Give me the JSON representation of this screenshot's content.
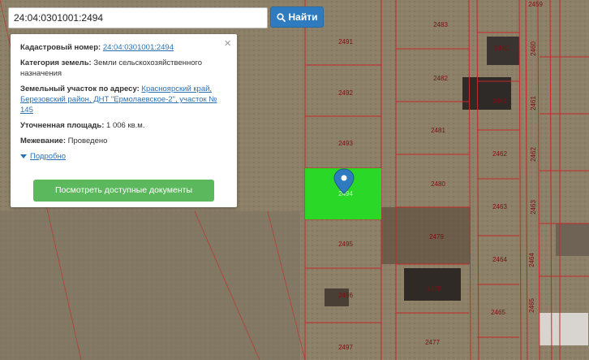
{
  "search": {
    "value": "24:04:0301001:2494",
    "button_label": "Найти"
  },
  "popup": {
    "cadastral_label": "Кадастровый номер:",
    "cadastral_value": "24:04:0301001:2494",
    "category_label": "Категория земель:",
    "category_value": "Земли сельскохозяйственного назначения",
    "address_label": "Земельный участок по адресу:",
    "address_value": "Красноярский край, Березовский район, ДНТ \"Ермолаевское-2\", участок № 145",
    "area_label": "Уточненная площадь:",
    "area_value": "1 006 кв.м.",
    "survey_label": "Межевание:",
    "survey_value": "Проведено",
    "details_label": "Подробно",
    "docs_button": "Посмотреть доступные документы",
    "close": "×"
  },
  "map": {
    "plot_labels": [
      "2491",
      "2492",
      "2493",
      "2494",
      "2495",
      "2496",
      "2497",
      "2483",
      "2482",
      "2481",
      "2480",
      "2479",
      "2478",
      "2477",
      "2460",
      "2461",
      "2462",
      "2463",
      "2464",
      "2465",
      "2459",
      "2460",
      "2461",
      "2462",
      "2463",
      "2464",
      "2465"
    ],
    "colors": {
      "boundary": "#c62828",
      "selected": "#22e022",
      "marker": "#2f7bbf"
    }
  }
}
